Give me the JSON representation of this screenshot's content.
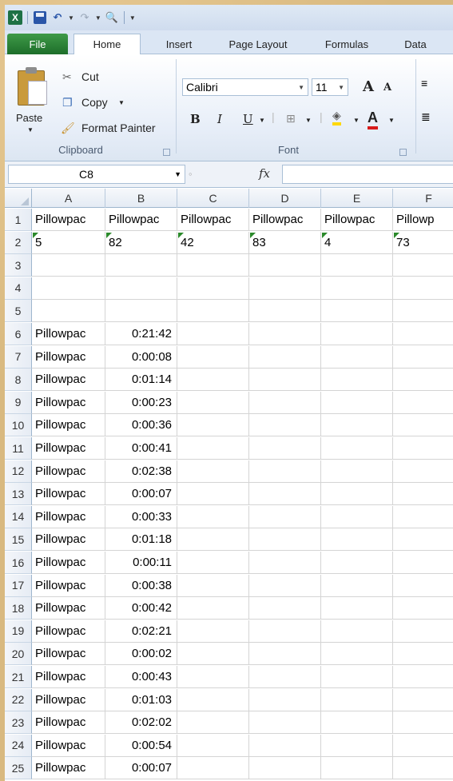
{
  "ribbon_tabs": [
    "File",
    "Home",
    "Insert",
    "Page Layout",
    "Formulas",
    "Data"
  ],
  "clipboard": {
    "paste_label": "Paste",
    "cut_label": "Cut",
    "copy_label": "Copy",
    "format_painter_label": "Format Painter",
    "group_label": "Clipboard"
  },
  "font": {
    "name": "Calibri",
    "size": "11",
    "grow": "A",
    "shrink": "A",
    "bold": "B",
    "italic": "I",
    "underline": "U",
    "color_letter": "A",
    "group_label": "Font"
  },
  "formula_bar": {
    "name_box": "C8",
    "fx": "fx",
    "formula": ""
  },
  "columns": [
    "A",
    "B",
    "C",
    "D",
    "E",
    "F"
  ],
  "rows": [
    {
      "n": "1",
      "cells": [
        "Pillowpac",
        "Pillowpac",
        "Pillowpac",
        "Pillowpac",
        "Pillowpac",
        "Pillowp"
      ]
    },
    {
      "n": "2",
      "cells": [
        "5",
        "82",
        "42",
        "83",
        "4",
        "73"
      ]
    },
    {
      "n": "3",
      "cells": [
        "",
        "",
        "",
        "",
        "",
        ""
      ]
    },
    {
      "n": "4",
      "cells": [
        "",
        "",
        "",
        "",
        "",
        ""
      ]
    },
    {
      "n": "5",
      "cells": [
        "",
        "",
        "",
        "",
        "",
        ""
      ]
    },
    {
      "n": "6",
      "cells": [
        "Pillowpac",
        "0:21:42",
        "",
        "",
        "",
        ""
      ]
    },
    {
      "n": "7",
      "cells": [
        "Pillowpac",
        "0:00:08",
        "",
        "",
        "",
        ""
      ]
    },
    {
      "n": "8",
      "cells": [
        "Pillowpac",
        "0:01:14",
        "",
        "",
        "",
        ""
      ]
    },
    {
      "n": "9",
      "cells": [
        "Pillowpac",
        "0:00:23",
        "",
        "",
        "",
        ""
      ]
    },
    {
      "n": "10",
      "cells": [
        "Pillowpac",
        "0:00:36",
        "",
        "",
        "",
        ""
      ]
    },
    {
      "n": "11",
      "cells": [
        "Pillowpac",
        "0:00:41",
        "",
        "",
        "",
        ""
      ]
    },
    {
      "n": "12",
      "cells": [
        "Pillowpac",
        "0:02:38",
        "",
        "",
        "",
        ""
      ]
    },
    {
      "n": "13",
      "cells": [
        "Pillowpac",
        "0:00:07",
        "",
        "",
        "",
        ""
      ]
    },
    {
      "n": "14",
      "cells": [
        "Pillowpac",
        "0:00:33",
        "",
        "",
        "",
        ""
      ]
    },
    {
      "n": "15",
      "cells": [
        "Pillowpac",
        "0:01:18",
        "",
        "",
        "",
        ""
      ]
    },
    {
      "n": "16",
      "cells": [
        "Pillowpac",
        "0:00:11",
        "",
        "",
        "",
        ""
      ]
    },
    {
      "n": "17",
      "cells": [
        "Pillowpac",
        "0:00:38",
        "",
        "",
        "",
        ""
      ]
    },
    {
      "n": "18",
      "cells": [
        "Pillowpac",
        "0:00:42",
        "",
        "",
        "",
        ""
      ]
    },
    {
      "n": "19",
      "cells": [
        "Pillowpac",
        "0:02:21",
        "",
        "",
        "",
        ""
      ]
    },
    {
      "n": "20",
      "cells": [
        "Pillowpac",
        "0:00:02",
        "",
        "",
        "",
        ""
      ]
    },
    {
      "n": "21",
      "cells": [
        "Pillowpac",
        "0:00:43",
        "",
        "",
        "",
        ""
      ]
    },
    {
      "n": "22",
      "cells": [
        "Pillowpac",
        "0:01:03",
        "",
        "",
        "",
        ""
      ]
    },
    {
      "n": "23",
      "cells": [
        "Pillowpac",
        "0:02:02",
        "",
        "",
        "",
        ""
      ]
    },
    {
      "n": "24",
      "cells": [
        "Pillowpac",
        "0:00:54",
        "",
        "",
        "",
        ""
      ]
    },
    {
      "n": "25",
      "cells": [
        "Pillowpac",
        "0:00:07",
        "",
        "",
        "",
        ""
      ]
    }
  ]
}
